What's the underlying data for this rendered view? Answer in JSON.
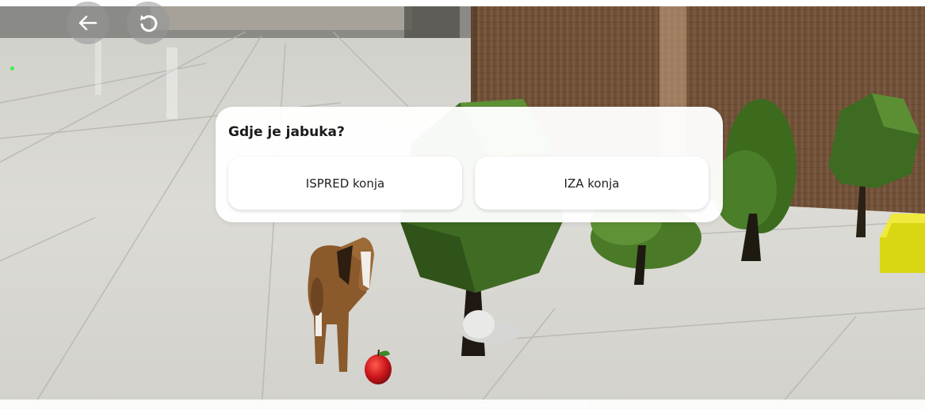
{
  "nav": {
    "back_icon": "arrow-left-icon",
    "reset_icon": "rotate-ccw-icon"
  },
  "quiz": {
    "question": "Gdje je jabuka?",
    "answers": [
      "ISPRED konja",
      "IZA konja"
    ]
  },
  "colors": {
    "dialog_bg": "#ffffff",
    "floor": "#d9d8d3",
    "fence": "#6e4f37",
    "tree_green": "#3f6b21",
    "apple_red": "#c9151b",
    "horse_brown": "#8a5a2c"
  }
}
